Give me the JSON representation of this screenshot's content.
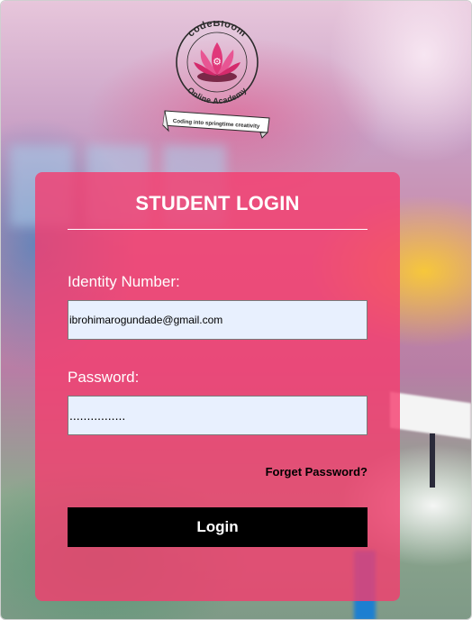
{
  "logo": {
    "name": "codeBloom",
    "subtitle": "Online Academy",
    "tagline": "Coding into springtime creativity",
    "icon": "lotus-flower-icon"
  },
  "login": {
    "title": "STUDENT LOGIN",
    "identity_label": "Identity Number:",
    "identity_value": "ibrohimarogundade@gmail.com",
    "password_label": "Password:",
    "password_value": "................",
    "forget_link": "Forget Password?",
    "submit_label": "Login"
  },
  "colors": {
    "card": "#f53c6e",
    "button": "#000000",
    "input_bg": "#e8f0fe",
    "logo_pink": "#e0387a"
  }
}
